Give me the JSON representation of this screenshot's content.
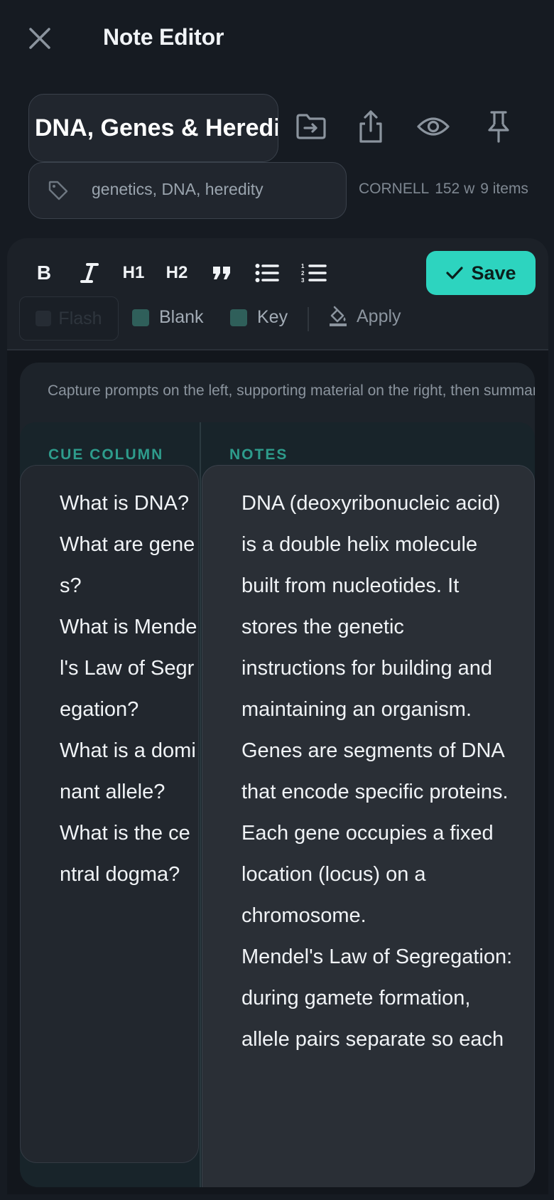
{
  "header": {
    "title": "Note Editor"
  },
  "note": {
    "title": "DNA, Genes & Heredity",
    "tags": "genetics, DNA, heredity",
    "meta": {
      "template": "CORNELL",
      "words": "152 w",
      "items": "9 items"
    }
  },
  "toolbar": {
    "bold": "B",
    "h1": "H1",
    "h2": "H2",
    "save_label": "Save",
    "flash_label": "Flash",
    "blank_label": "Blank",
    "key_label": "Key",
    "apply_label": "Apply"
  },
  "cornell": {
    "instructions": "Capture prompts on the left, supporting material on the right, then summarize at the bottom.",
    "cue_header": "CUE COLUMN",
    "notes_header": "NOTES",
    "cues": [
      "What is DNA?",
      "What are genes?",
      "What is Mendel's Law of Segregation?",
      "What is a dominant allele?",
      "What is the central dogma?"
    ],
    "notes": [
      "DNA (deoxyribonucleic acid) is a double helix molecule built from nucleotides. It stores the genetic instructions for building and maintaining an organism.",
      "Genes are segments of DNA that encode specific proteins. Each gene occupies a fixed location (locus) on a chromosome.",
      "Mendel's Law of Segregation: during gamete formation, allele pairs separate so each"
    ]
  },
  "colors": {
    "accent": "#2dd4bf",
    "background": "#161b22",
    "header_teal": "#2e9c8c"
  }
}
